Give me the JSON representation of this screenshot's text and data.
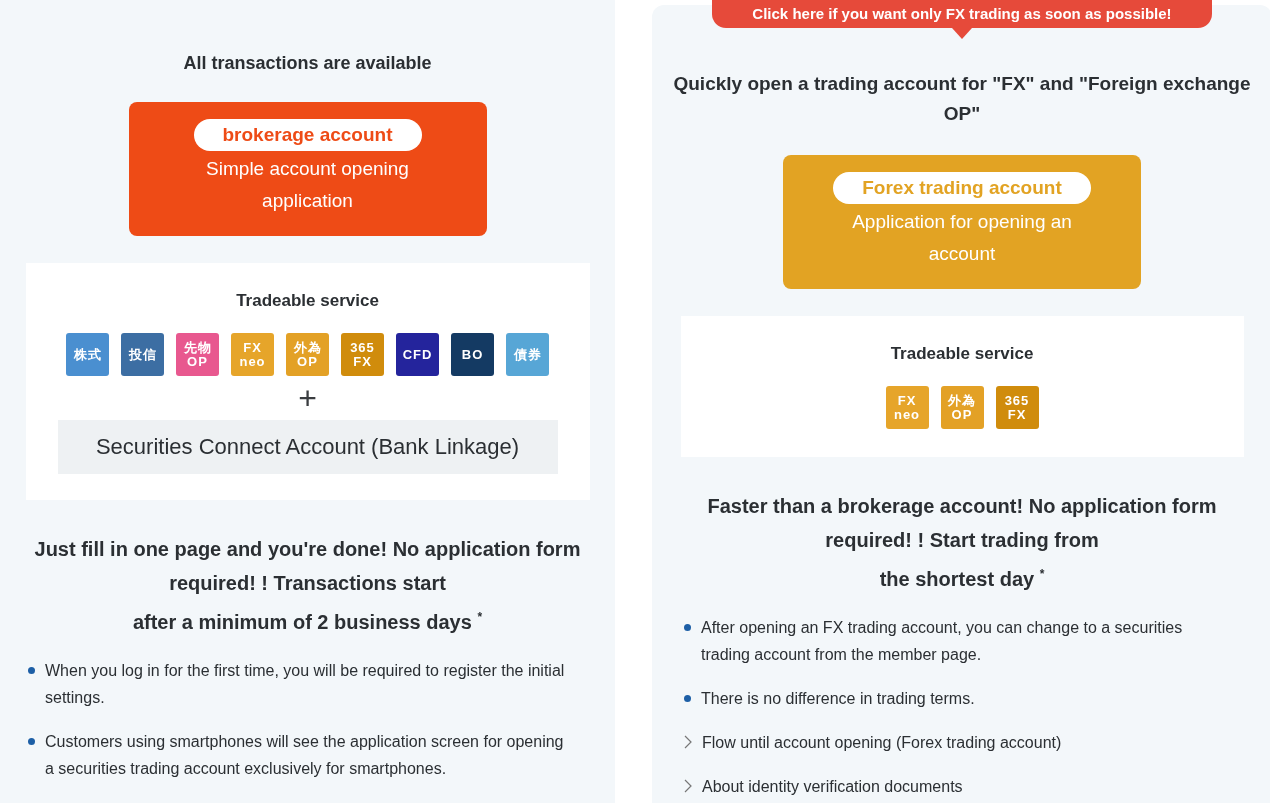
{
  "columns": [
    {
      "intro": "All transactions are available",
      "account": {
        "name": "brokerage account",
        "description": "Simple account opening application",
        "color": "#ee4b16"
      },
      "services": {
        "title": "Tradeable service",
        "items": [
          {
            "lines": [
              "株式"
            ],
            "color": "#4a8fd0"
          },
          {
            "lines": [
              "投信"
            ],
            "color": "#3c6ea3"
          },
          {
            "lines": [
              "先物",
              "OP"
            ],
            "color": "#e8588f"
          },
          {
            "lines": [
              "FX",
              "neo"
            ],
            "color": "#e6a52a"
          },
          {
            "lines": [
              "外為",
              "OP"
            ],
            "color": "#e3a126"
          },
          {
            "lines": [
              "365",
              "FX"
            ],
            "color": "#d08c0c"
          },
          {
            "lines": [
              "CFD"
            ],
            "color": "#24249c"
          },
          {
            "lines": [
              "BO"
            ],
            "color": "#143a63"
          },
          {
            "lines": [
              "債券"
            ],
            "color": "#57a6d6"
          }
        ],
        "plus": "+",
        "extra": "Securities Connect Account (Bank Linkage)"
      },
      "heading_lines": [
        "Just fill in one page and you're done! No application form required! ! Transactions start",
        "after a minimum of 2 business days $^{*}$"
      ],
      "notes": [
        {
          "kind": "bullet",
          "text": "When you log in for the first time, you will be required to register the initial settings."
        },
        {
          "kind": "bullet",
          "text": "Customers using smartphones will see the application screen for opening a securities trading account exclusively for smartphones."
        }
      ]
    },
    {
      "banner": "Click here if you want only FX trading as soon as possible!",
      "intro": "Quickly open a trading account for \"FX\" and \"Foreign exchange OP\"",
      "account": {
        "name": "Forex trading account",
        "description": "Application for opening an account",
        "color": "#e2a323"
      },
      "services": {
        "title": "Tradeable service",
        "items": [
          {
            "lines": [
              "FX",
              "neo"
            ],
            "color": "#e6a52a"
          },
          {
            "lines": [
              "外為",
              "OP"
            ],
            "color": "#e3a126"
          },
          {
            "lines": [
              "365",
              "FX"
            ],
            "color": "#d08c0c"
          }
        ]
      },
      "heading_lines": [
        "Faster than a brokerage account! No application form required! ! Start trading from",
        "the shortest day $^{*}$"
      ],
      "notes": [
        {
          "kind": "bullet",
          "text": "After opening an FX trading account, you can change to a securities trading account from the member page."
        },
        {
          "kind": "bullet",
          "text": "There is no difference in trading terms."
        },
        {
          "kind": "link",
          "text": "Flow until account opening (Forex trading account)"
        },
        {
          "kind": "link",
          "text": "About identity verification documents"
        }
      ]
    }
  ]
}
